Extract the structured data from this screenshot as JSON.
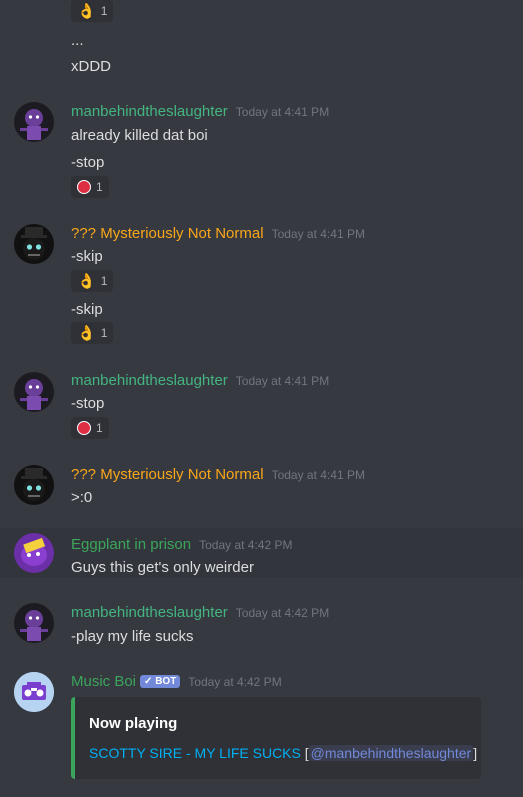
{
  "reaction_count": "1",
  "messages": {
    "top": {
      "line1": "...",
      "line2": "xDDD"
    },
    "m1": {
      "author": "manbehindtheslaughter",
      "time": "Today at 4:41 PM",
      "line1": "already killed dat boi",
      "line2": "-stop"
    },
    "m2": {
      "author": "??? Mysteriously Not Normal",
      "time": "Today at 4:41 PM",
      "line1": "-skip",
      "line2": "-skip"
    },
    "m3": {
      "author": "manbehindtheslaughter",
      "time": "Today at 4:41 PM",
      "line1": "-stop"
    },
    "m4": {
      "author": "??? Mysteriously Not Normal",
      "time": "Today at 4:41 PM",
      "line1": ">:0"
    },
    "m5": {
      "author": "Eggplant in prison",
      "time": "Today at 4:42 PM",
      "line1": "Guys this get's only weirder"
    },
    "m6": {
      "author": "manbehindtheslaughter",
      "time": "Today at 4:42 PM",
      "line1": "-play my life sucks"
    },
    "m7": {
      "author": "Music Boi",
      "bot_tag": "✓ BOT",
      "time": "Today at 4:42 PM",
      "embed_title": "Now playing",
      "embed_song": "SCOTTY SIRE - MY LIFE SUCKS",
      "embed_open": "[",
      "embed_mention": "@manbehindtheslaughter",
      "embed_close": "]"
    }
  },
  "colors": {
    "green_name": "#43b581",
    "yellow_name": "#faa61a",
    "bot_badge": "#7289da",
    "link": "#00b0f4"
  },
  "icons": {
    "ok_hand": "👌",
    "stop": "stop-sign"
  }
}
